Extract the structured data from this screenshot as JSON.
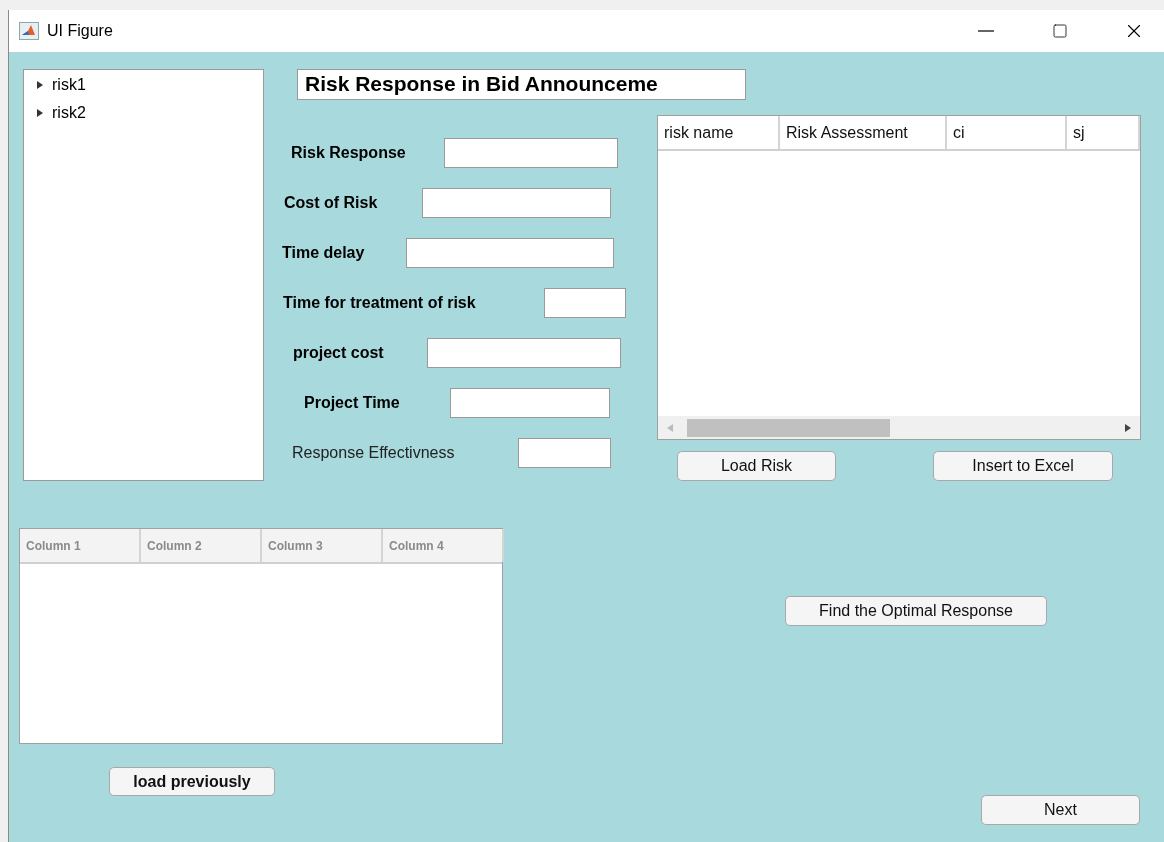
{
  "window": {
    "title": "UI Figure"
  },
  "tree": {
    "items": [
      {
        "label": "risk1",
        "expanded": false
      },
      {
        "label": "risk2",
        "expanded": false
      }
    ]
  },
  "heading": "Risk Response in Bid Announceme",
  "form": {
    "fields": [
      {
        "label": "Risk Response",
        "bold": true
      },
      {
        "label": "Cost of Risk",
        "bold": true
      },
      {
        "label": "Time delay",
        "bold": true
      },
      {
        "label": "Time for treatment of risk",
        "bold": true
      },
      {
        "label": "project cost",
        "bold": true
      },
      {
        "label": "Project Time",
        "bold": true
      },
      {
        "label": "Response Effectivness",
        "bold": false
      }
    ]
  },
  "risk_table": {
    "columns": [
      "risk name",
      "Risk Assessment",
      "ci",
      "sj"
    ]
  },
  "risk_buttons": [
    "Load Risk",
    "Insert to Excel"
  ],
  "result_table": {
    "columns": [
      "Column 1",
      "Column 2",
      "Column 3",
      "Column 4"
    ]
  },
  "load_button": "load previously",
  "optimal_button": "Find the Optimal Response",
  "next_button": "Next"
}
